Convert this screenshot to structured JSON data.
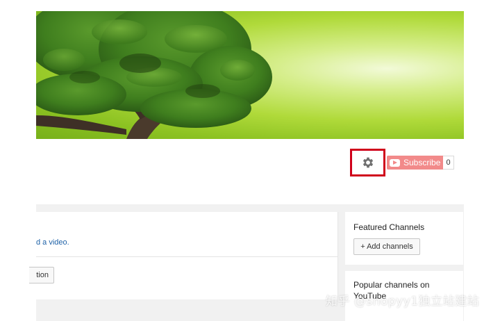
{
  "header": {
    "subscribe_label": "Subscribe",
    "subscriber_count": "0"
  },
  "main": {
    "upload_link_text": "d a video.",
    "partial_button_label": "tion"
  },
  "sidebar": {
    "featured_title": "Featured Channels",
    "add_channels_label": "+ Add channels",
    "popular_title": "Popular channels on YouTube"
  },
  "watermark_text": "知乎 @shopyy1独立站建站",
  "icons": {
    "settings": "gear-icon",
    "subscribe": "youtube-play-icon"
  },
  "colors": {
    "highlight_border": "#d0021b",
    "subscribe_bg": "#f28a8a",
    "link": "#1f62a8",
    "banner_green": "#8cc222"
  }
}
